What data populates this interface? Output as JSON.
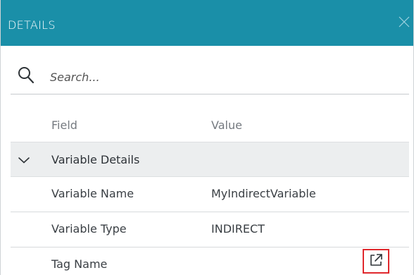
{
  "header": {
    "title": "DETAILS",
    "close_icon": "close-icon"
  },
  "search": {
    "placeholder": "Search...",
    "value": "",
    "icon": "search-icon"
  },
  "columns": {
    "field": "Field",
    "value": "Value"
  },
  "group": {
    "label": "Variable Details",
    "expanded": true,
    "icon": "chevron-down-icon"
  },
  "rows": [
    {
      "field": "Variable Name",
      "value": "MyIndirectVariable"
    },
    {
      "field": "Variable Type",
      "value": "INDIRECT"
    },
    {
      "field": "Tag Name",
      "value": ""
    }
  ],
  "tag_link": {
    "icon": "external-link-icon",
    "highlight_color": "#e0282d"
  },
  "colors": {
    "header_bg": "#1a8fa8",
    "group_bg": "#eceeef"
  }
}
